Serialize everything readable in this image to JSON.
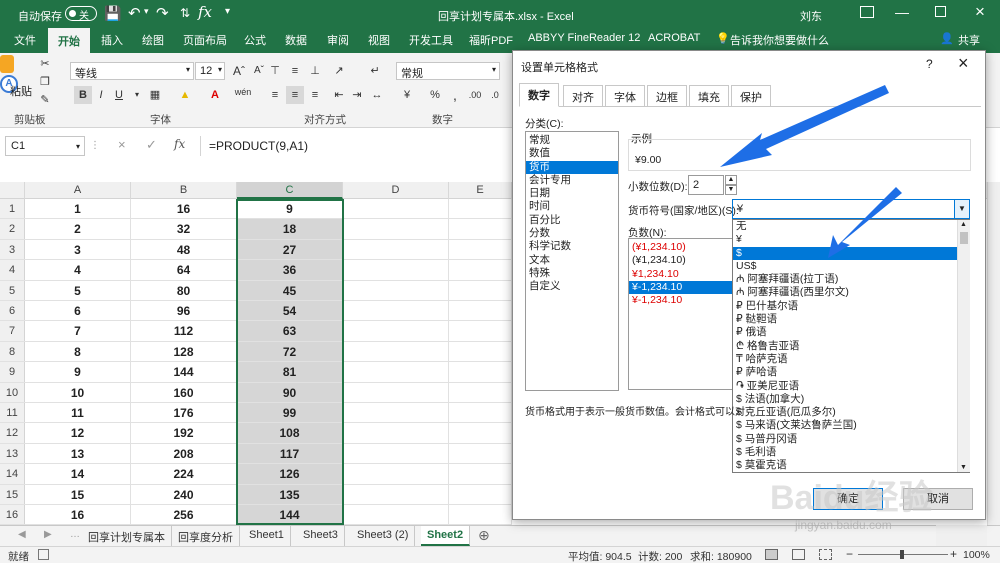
{
  "titlebar": {
    "autosave": "自动保存",
    "autosave_state": "关",
    "title": "回享计划专属本.xlsx  -  Excel",
    "user": "刘东"
  },
  "ribbon_tabs": [
    "文件",
    "开始",
    "插入",
    "绘图",
    "页面布局",
    "公式",
    "数据",
    "审阅",
    "视图",
    "开发工具",
    "福昕PDF",
    "ABBYY FineReader 12",
    "ACROBAT"
  ],
  "tell_me": "告诉我你想要做什么",
  "share": "共享",
  "ribbon": {
    "paste": "粘贴",
    "font_name": "等线",
    "font_size": "12",
    "number_format": "常规",
    "groups": [
      "剪贴板",
      "字体",
      "对齐方式",
      "数字"
    ]
  },
  "formula_bar": {
    "name_box": "C1",
    "fx": "fx",
    "formula": "=PRODUCT(9,A1)"
  },
  "columns": [
    "A",
    "B",
    "C",
    "D",
    "E"
  ],
  "rows": [
    {
      "n": "1",
      "a": "1",
      "b": "16",
      "c": "9"
    },
    {
      "n": "2",
      "a": "2",
      "b": "32",
      "c": "18"
    },
    {
      "n": "3",
      "a": "3",
      "b": "48",
      "c": "27"
    },
    {
      "n": "4",
      "a": "4",
      "b": "64",
      "c": "36"
    },
    {
      "n": "5",
      "a": "5",
      "b": "80",
      "c": "45"
    },
    {
      "n": "6",
      "a": "6",
      "b": "96",
      "c": "54"
    },
    {
      "n": "7",
      "a": "7",
      "b": "112",
      "c": "63"
    },
    {
      "n": "8",
      "a": "8",
      "b": "128",
      "c": "72"
    },
    {
      "n": "9",
      "a": "9",
      "b": "144",
      "c": "81"
    },
    {
      "n": "10",
      "a": "10",
      "b": "160",
      "c": "90"
    },
    {
      "n": "11",
      "a": "11",
      "b": "176",
      "c": "99"
    },
    {
      "n": "12",
      "a": "12",
      "b": "192",
      "c": "108"
    },
    {
      "n": "13",
      "a": "13",
      "b": "208",
      "c": "117"
    },
    {
      "n": "14",
      "a": "14",
      "b": "224",
      "c": "126"
    },
    {
      "n": "15",
      "a": "15",
      "b": "240",
      "c": "135"
    },
    {
      "n": "16",
      "a": "16",
      "b": "256",
      "c": "144"
    }
  ],
  "sheet_tabs": [
    "回享计划专属本",
    "回享度分析",
    "Sheet1",
    "Sheet3",
    "Sheet3 (2)",
    "Sheet2"
  ],
  "statusbar": {
    "ready": "就绪",
    "average": "平均值: 904.5",
    "count": "计数: 200",
    "sum": "求和: 180900",
    "zoom": "100%"
  },
  "dialog": {
    "title": "设置单元格格式",
    "help": "?",
    "close": "×",
    "tabs": [
      "数字",
      "对齐",
      "字体",
      "边框",
      "填充",
      "保护"
    ],
    "category_label": "分类(C):",
    "categories": [
      "常规",
      "数值",
      "货币",
      "会计专用",
      "日期",
      "时间",
      "百分比",
      "分数",
      "科学记数",
      "文本",
      "特殊",
      "自定义"
    ],
    "sample_label": "示例",
    "sample_value": "¥9.00",
    "decimal_label": "小数位数(D):",
    "decimal_value": "2",
    "symbol_label": "货币符号(国家/地区)(S):",
    "symbol_value": "¥",
    "negative_label": "负数(N):",
    "negatives": [
      "(¥1,234.10)",
      "(¥1,234.10)",
      "¥1,234.10",
      "¥-1,234.10",
      "¥-1,234.10"
    ],
    "symbol_options": [
      "无",
      "¥",
      "$",
      "US$",
      "₼ 阿塞拜疆语(拉丁语)",
      "₼ 阿塞拜疆语(西里尔文)",
      "₽ 巴什基尔语",
      "₽ 鞑靼语",
      "₽ 俄语",
      "₾ 格鲁吉亚语",
      "₸ 哈萨克语",
      "₽ 萨哈语",
      "֏ 亚美尼亚语",
      "$ 法语(加拿大)",
      "$ 克丘亚语(厄瓜多尔)",
      "$ 马来语(文莱达鲁萨兰国)",
      "$ 马普丹冈语",
      "$ 毛利语",
      "$ 莫霍克语"
    ],
    "description": "货币格式用于表示一般货币数值。会计格式可以对",
    "ok": "确定",
    "cancel": "取消"
  },
  "watermark": "Baidu经验",
  "watermark_url": "jingyan.baidu.com"
}
